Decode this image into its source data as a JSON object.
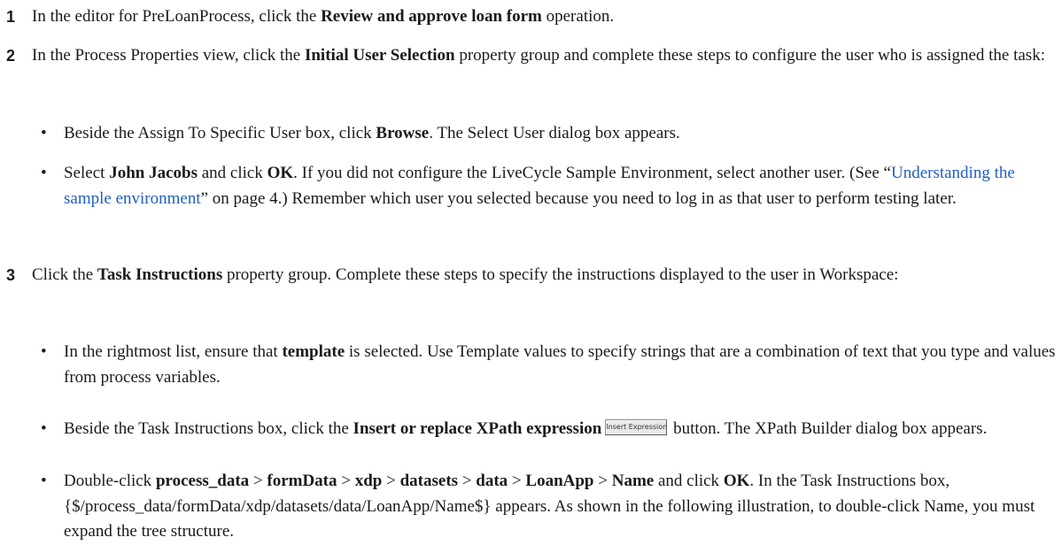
{
  "steps": [
    {
      "number": "1",
      "t1": "In the editor for PreLoanProcess, click the ",
      "b1": "Review and approve loan form",
      "t2": " operation."
    },
    {
      "number": "2",
      "t1": "In the Process Properties view, click the ",
      "b1": "Initial User Selection",
      "t2": " property group and complete these steps to configure the user who is assigned the task:",
      "bullets": [
        {
          "t1": "Beside the Assign To Specific User box, click ",
          "b1": "Browse",
          "t2": ". The Select User dialog box appears."
        },
        {
          "t1": "Select ",
          "b1": "John Jacobs",
          "t2": " and click ",
          "b2": "OK",
          "t3": ". If you did not configure the LiveCycle Sample Environment, select another user. (See “",
          "link": "Understanding the sample environment",
          "t4": "” on page 4.) Remember which user you selected because you need to log in as that user to perform testing later."
        }
      ]
    },
    {
      "number": "3",
      "t1": "Click the ",
      "b1": "Task Instructions",
      "t2": " property group. Complete these steps to specify the instructions displayed to the user in Workspace:",
      "bullets": [
        {
          "t1": "In the rightmost list, ensure that ",
          "b1": "template",
          "t2": " is selected. Use Template values to specify strings that are a combination of text that you type and values from process variables."
        },
        {
          "t1": "Beside the Task Instructions box, click the ",
          "b1": "Insert or replace XPath expression",
          "button_label": "Insert Expression...",
          "t2": " button. The XPath Builder dialog box appears."
        },
        {
          "t1": "Double-click ",
          "p1": "process_data",
          "s1": " > ",
          "p2": "formData",
          "s2": " > ",
          "p3": "xdp",
          "s3": " > ",
          "p4": "datasets",
          "s4": " > ",
          "p5": "data",
          "s5": " > ",
          "p6": "LoanApp",
          "s6": " > ",
          "p7": "Name",
          "t2": " and click ",
          "b2": "OK",
          "t3": ". In the Task Instructions box, {$/process_data/formData/xdp/datasets/data/LoanApp/Name$} appears. As shown in the following illustration, to double-click Name, you must expand the tree structure."
        }
      ]
    }
  ],
  "colors": {
    "text": "#1a1a1a",
    "link": "#1f5fbf"
  }
}
